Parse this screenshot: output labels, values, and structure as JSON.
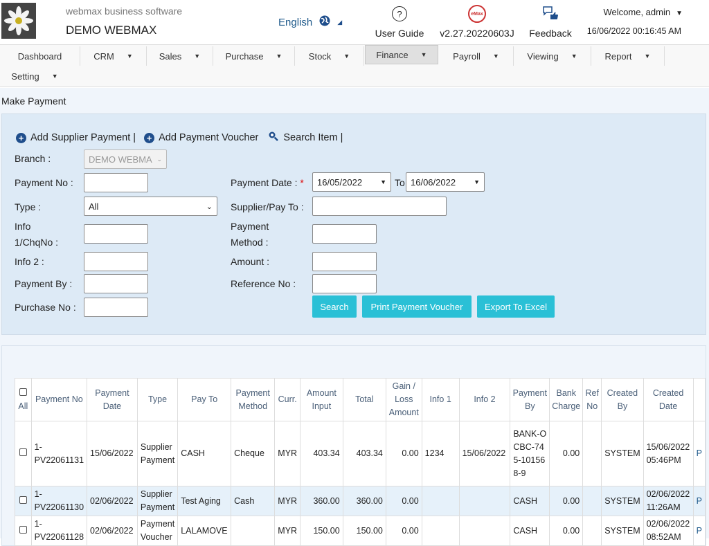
{
  "header": {
    "brand": "webmax business software",
    "company": "DEMO WEBMAX",
    "language": "English",
    "user_guide": "User Guide",
    "user_guide_icon": "?",
    "version": "v2.27.20220603J",
    "version_logo": "eMax",
    "feedback": "Feedback",
    "welcome": "Welcome, admin",
    "datetime": "16/06/2022 00:16:45 AM"
  },
  "nav": [
    "Dashboard",
    "CRM",
    "Sales",
    "Purchase",
    "Stock",
    "Finance",
    "Payroll",
    "Viewing",
    "Report",
    "Setting"
  ],
  "page": {
    "title": "Make Payment",
    "actions": {
      "add_supplier_payment": "Add Supplier Payment |",
      "add_payment_voucher": "Add Payment Voucher",
      "search_item": "Search Item |"
    },
    "form": {
      "branch_label": "Branch :",
      "branch_value": "DEMO WEBMA",
      "payment_no_label": "Payment No :",
      "type_label": "Type :",
      "type_value": "All",
      "info1_label_a": "Info",
      "info1_label_b": "1/ChqNo :",
      "info2_label": "Info 2 :",
      "payment_by_label": "Payment By :",
      "purchase_no_label": "Purchase No :",
      "payment_date_label": "Payment Date :",
      "required_mark": "*",
      "date_from": "16/05/2022",
      "to_label": "To",
      "date_to": "16/06/2022",
      "supplier_label": "Supplier/Pay To :",
      "payment_method_label_a": "Payment",
      "payment_method_label_b": "Method :",
      "amount_label": "Amount :",
      "reference_label": "Reference No :",
      "search_button": "Search",
      "print_button": "Print Payment Voucher",
      "export_button": "Export To Excel"
    }
  },
  "table": {
    "headers": {
      "all": "All",
      "payment_no": "Payment No",
      "payment_date": "Payment Date",
      "type": "Type",
      "pay_to": "Pay To",
      "payment_method": "Payment Method",
      "curr": "Curr.",
      "amount_input": "Amount Input",
      "total": "Total",
      "gain_loss": "Gain / Loss Amount",
      "info1": "Info 1",
      "info2": "Info 2",
      "payment_by": "Payment By",
      "bank_charge": "Bank Charge",
      "ref_no": "Ref No",
      "created_by": "Created By",
      "created_date": "Created Date"
    },
    "rows": [
      {
        "payment_no": "1-PV22061131",
        "payment_date": "15/06/2022",
        "type": "Supplier Payment",
        "pay_to": "CASH",
        "payment_method": "Cheque",
        "curr": "MYR",
        "amount_input": "403.34",
        "total": "403.34",
        "gain_loss": "0.00",
        "info1": "1234",
        "info2": "15/06/2022",
        "payment_by": "BANK-OCBC-745-101568-9",
        "bank_charge": "0.00",
        "ref_no": "",
        "created_by": "SYSTEM",
        "created_date": "15/06/2022 05:46PM",
        "link": "P"
      },
      {
        "payment_no": "1-PV22061130",
        "payment_date": "02/06/2022",
        "type": "Supplier Payment",
        "pay_to": "Test Aging",
        "payment_method": "Cash",
        "curr": "MYR",
        "amount_input": "360.00",
        "total": "360.00",
        "gain_loss": "0.00",
        "info1": "",
        "info2": "",
        "payment_by": "CASH",
        "bank_charge": "0.00",
        "ref_no": "",
        "created_by": "SYSTEM",
        "created_date": "02/06/2022 11:26AM",
        "link": "P"
      },
      {
        "payment_no": "1-PV22061128",
        "payment_date": "02/06/2022",
        "type": "Payment Voucher",
        "pay_to": "LALAMOVE",
        "payment_method": "",
        "curr": "MYR",
        "amount_input": "150.00",
        "total": "150.00",
        "gain_loss": "0.00",
        "info1": "",
        "info2": "",
        "payment_by": "CASH",
        "bank_charge": "0.00",
        "ref_no": "",
        "created_by": "SYSTEM",
        "created_date": "02/06/2022 08:52AM",
        "link": "P"
      }
    ]
  },
  "colors": {
    "accent": "#2ac0d6",
    "panel": "#ddeaf6",
    "link": "#1f5a8b"
  }
}
